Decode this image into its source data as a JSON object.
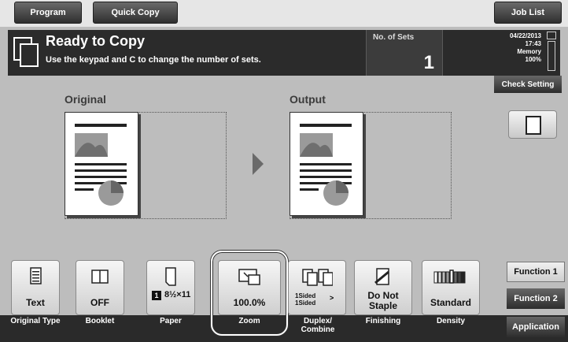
{
  "topbar": {
    "program_label": "Program",
    "quick_copy_label": "Quick Copy",
    "job_list_label": "Job List"
  },
  "status": {
    "title": "Ready to Copy",
    "message": "Use the keypad and C to change the number of sets.",
    "sets_label": "No. of Sets",
    "sets_value": "1",
    "date": "04/22/2013",
    "time": "17:43",
    "memory_label": "Memory",
    "memory_value": "100%",
    "memory_fraction": 1.0
  },
  "check_setting_label": "Check Setting",
  "preview": {
    "original_label": "Original",
    "output_label": "Output"
  },
  "functions": [
    {
      "key": "original-type",
      "value": "Text",
      "caption": "Original Type"
    },
    {
      "key": "booklet",
      "value": "OFF",
      "caption": "Booklet"
    },
    {
      "key": "paper",
      "tray": "1",
      "value": "8½×11",
      "caption": "Paper"
    },
    {
      "key": "zoom",
      "value": "100.0%",
      "caption": "Zoom"
    },
    {
      "key": "duplex",
      "value_top": "1Sided",
      "value_bottom": "1Sided",
      "caption_line1": "Duplex/",
      "caption_line2": "Combine"
    },
    {
      "key": "finishing",
      "value_line1": "Do Not",
      "value_line2": "Staple",
      "caption": "Finishing"
    },
    {
      "key": "density",
      "value": "Standard",
      "caption": "Density"
    }
  ],
  "side_menu": [
    {
      "label": "Function 1",
      "active": true
    },
    {
      "label": "Function 2",
      "active": false
    },
    {
      "label": "Application",
      "active": false
    }
  ]
}
